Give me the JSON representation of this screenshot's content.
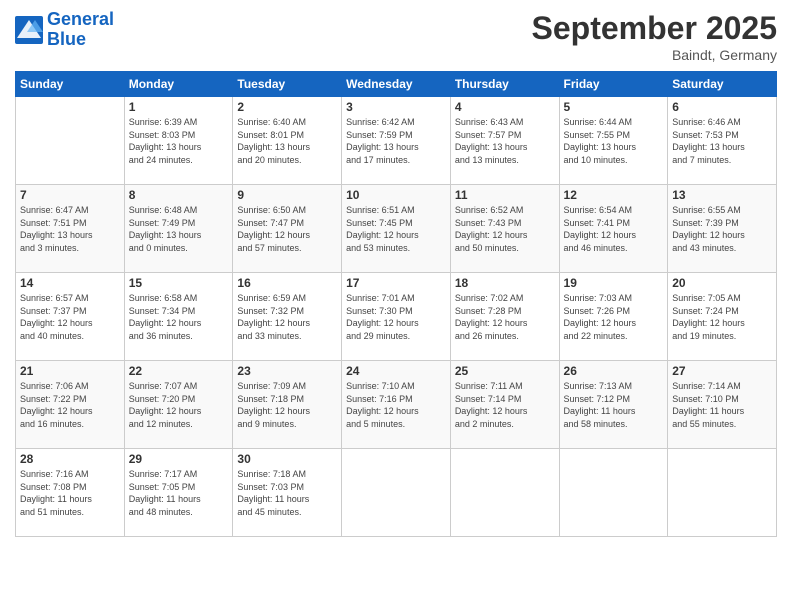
{
  "header": {
    "logo_line1": "General",
    "logo_line2": "Blue",
    "month": "September 2025",
    "location": "Baindt, Germany"
  },
  "weekdays": [
    "Sunday",
    "Monday",
    "Tuesday",
    "Wednesday",
    "Thursday",
    "Friday",
    "Saturday"
  ],
  "weeks": [
    [
      {
        "day": "",
        "info": ""
      },
      {
        "day": "1",
        "info": "Sunrise: 6:39 AM\nSunset: 8:03 PM\nDaylight: 13 hours\nand 24 minutes."
      },
      {
        "day": "2",
        "info": "Sunrise: 6:40 AM\nSunset: 8:01 PM\nDaylight: 13 hours\nand 20 minutes."
      },
      {
        "day": "3",
        "info": "Sunrise: 6:42 AM\nSunset: 7:59 PM\nDaylight: 13 hours\nand 17 minutes."
      },
      {
        "day": "4",
        "info": "Sunrise: 6:43 AM\nSunset: 7:57 PM\nDaylight: 13 hours\nand 13 minutes."
      },
      {
        "day": "5",
        "info": "Sunrise: 6:44 AM\nSunset: 7:55 PM\nDaylight: 13 hours\nand 10 minutes."
      },
      {
        "day": "6",
        "info": "Sunrise: 6:46 AM\nSunset: 7:53 PM\nDaylight: 13 hours\nand 7 minutes."
      }
    ],
    [
      {
        "day": "7",
        "info": "Sunrise: 6:47 AM\nSunset: 7:51 PM\nDaylight: 13 hours\nand 3 minutes."
      },
      {
        "day": "8",
        "info": "Sunrise: 6:48 AM\nSunset: 7:49 PM\nDaylight: 13 hours\nand 0 minutes."
      },
      {
        "day": "9",
        "info": "Sunrise: 6:50 AM\nSunset: 7:47 PM\nDaylight: 12 hours\nand 57 minutes."
      },
      {
        "day": "10",
        "info": "Sunrise: 6:51 AM\nSunset: 7:45 PM\nDaylight: 12 hours\nand 53 minutes."
      },
      {
        "day": "11",
        "info": "Sunrise: 6:52 AM\nSunset: 7:43 PM\nDaylight: 12 hours\nand 50 minutes."
      },
      {
        "day": "12",
        "info": "Sunrise: 6:54 AM\nSunset: 7:41 PM\nDaylight: 12 hours\nand 46 minutes."
      },
      {
        "day": "13",
        "info": "Sunrise: 6:55 AM\nSunset: 7:39 PM\nDaylight: 12 hours\nand 43 minutes."
      }
    ],
    [
      {
        "day": "14",
        "info": "Sunrise: 6:57 AM\nSunset: 7:37 PM\nDaylight: 12 hours\nand 40 minutes."
      },
      {
        "day": "15",
        "info": "Sunrise: 6:58 AM\nSunset: 7:34 PM\nDaylight: 12 hours\nand 36 minutes."
      },
      {
        "day": "16",
        "info": "Sunrise: 6:59 AM\nSunset: 7:32 PM\nDaylight: 12 hours\nand 33 minutes."
      },
      {
        "day": "17",
        "info": "Sunrise: 7:01 AM\nSunset: 7:30 PM\nDaylight: 12 hours\nand 29 minutes."
      },
      {
        "day": "18",
        "info": "Sunrise: 7:02 AM\nSunset: 7:28 PM\nDaylight: 12 hours\nand 26 minutes."
      },
      {
        "day": "19",
        "info": "Sunrise: 7:03 AM\nSunset: 7:26 PM\nDaylight: 12 hours\nand 22 minutes."
      },
      {
        "day": "20",
        "info": "Sunrise: 7:05 AM\nSunset: 7:24 PM\nDaylight: 12 hours\nand 19 minutes."
      }
    ],
    [
      {
        "day": "21",
        "info": "Sunrise: 7:06 AM\nSunset: 7:22 PM\nDaylight: 12 hours\nand 16 minutes."
      },
      {
        "day": "22",
        "info": "Sunrise: 7:07 AM\nSunset: 7:20 PM\nDaylight: 12 hours\nand 12 minutes."
      },
      {
        "day": "23",
        "info": "Sunrise: 7:09 AM\nSunset: 7:18 PM\nDaylight: 12 hours\nand 9 minutes."
      },
      {
        "day": "24",
        "info": "Sunrise: 7:10 AM\nSunset: 7:16 PM\nDaylight: 12 hours\nand 5 minutes."
      },
      {
        "day": "25",
        "info": "Sunrise: 7:11 AM\nSunset: 7:14 PM\nDaylight: 12 hours\nand 2 minutes."
      },
      {
        "day": "26",
        "info": "Sunrise: 7:13 AM\nSunset: 7:12 PM\nDaylight: 11 hours\nand 58 minutes."
      },
      {
        "day": "27",
        "info": "Sunrise: 7:14 AM\nSunset: 7:10 PM\nDaylight: 11 hours\nand 55 minutes."
      }
    ],
    [
      {
        "day": "28",
        "info": "Sunrise: 7:16 AM\nSunset: 7:08 PM\nDaylight: 11 hours\nand 51 minutes."
      },
      {
        "day": "29",
        "info": "Sunrise: 7:17 AM\nSunset: 7:05 PM\nDaylight: 11 hours\nand 48 minutes."
      },
      {
        "day": "30",
        "info": "Sunrise: 7:18 AM\nSunset: 7:03 PM\nDaylight: 11 hours\nand 45 minutes."
      },
      {
        "day": "",
        "info": ""
      },
      {
        "day": "",
        "info": ""
      },
      {
        "day": "",
        "info": ""
      },
      {
        "day": "",
        "info": ""
      }
    ]
  ]
}
